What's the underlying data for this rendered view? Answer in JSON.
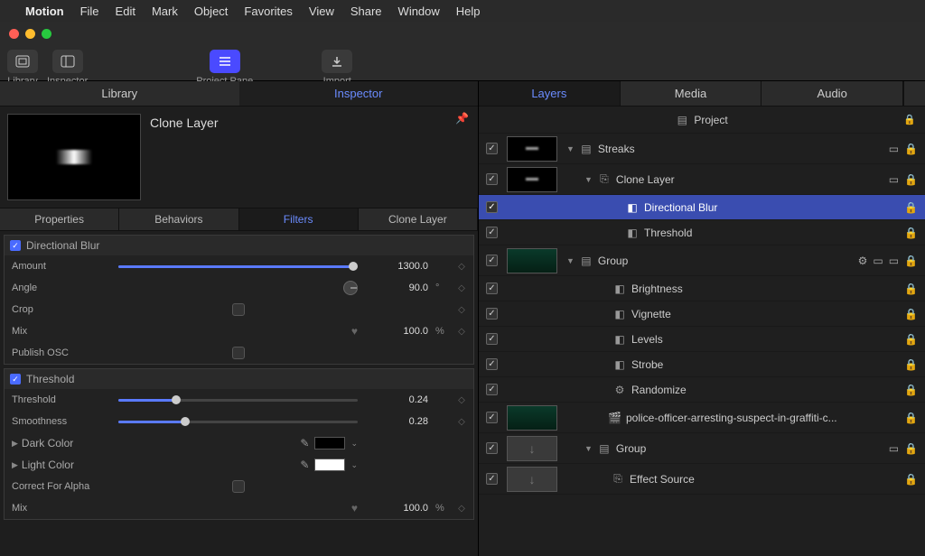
{
  "menubar": {
    "app": "Motion",
    "items": [
      "File",
      "Edit",
      "Mark",
      "Object",
      "Favorites",
      "View",
      "Share",
      "Window",
      "Help"
    ]
  },
  "toolbar": {
    "library": "Library",
    "inspector": "Inspector",
    "project_pane": "Project Pane",
    "import": "Import"
  },
  "left_tabs": {
    "library": "Library",
    "inspector": "Inspector"
  },
  "preview": {
    "title": "Clone Layer"
  },
  "subtabs": {
    "properties": "Properties",
    "behaviors": "Behaviors",
    "filters": "Filters",
    "clone": "Clone Layer"
  },
  "filters": {
    "directional_blur": {
      "title": "Directional Blur",
      "amount_label": "Amount",
      "amount_val": "1300.0",
      "angle_label": "Angle",
      "angle_val": "90.0",
      "angle_unit": "°",
      "crop_label": "Crop",
      "mix_label": "Mix",
      "mix_val": "100.0",
      "mix_unit": "%",
      "publish_label": "Publish OSC"
    },
    "threshold": {
      "title": "Threshold",
      "threshold_label": "Threshold",
      "threshold_val": "0.24",
      "smoothness_label": "Smoothness",
      "smoothness_val": "0.28",
      "dark_label": "Dark Color",
      "light_label": "Light Color",
      "correct_label": "Correct For Alpha",
      "mix_label": "Mix",
      "mix_val": "100.0",
      "mix_unit": "%"
    }
  },
  "right_tabs": {
    "layers": "Layers",
    "media": "Media",
    "audio": "Audio"
  },
  "layers": {
    "project": "Project",
    "streaks": "Streaks",
    "clone": "Clone Layer",
    "dir_blur": "Directional Blur",
    "threshold": "Threshold",
    "group": "Group",
    "brightness": "Brightness",
    "vignette": "Vignette",
    "levels": "Levels",
    "strobe": "Strobe",
    "randomize": "Randomize",
    "clip": "police-officer-arresting-suspect-in-graffiti-c...",
    "group2": "Group",
    "effect_source": "Effect Source"
  }
}
